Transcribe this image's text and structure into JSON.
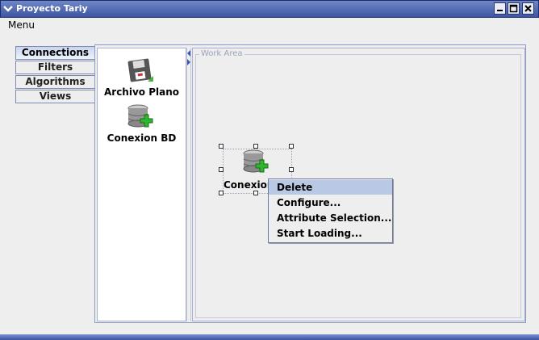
{
  "window": {
    "title": "Proyecto Tariy"
  },
  "menu": {
    "label": "Menu"
  },
  "tabs": [
    {
      "label": "Connections",
      "selected": true
    },
    {
      "label": "Filters",
      "selected": false
    },
    {
      "label": "Algorithms",
      "selected": false
    },
    {
      "label": "Views",
      "selected": false
    }
  ],
  "palette": {
    "items": [
      {
        "label": "Archivo Plano",
        "icon": "floppy-disk-icon"
      },
      {
        "label": "Conexion BD",
        "icon": "database-add-icon"
      }
    ]
  },
  "work_area": {
    "legend": "Work Area",
    "node": {
      "label": "Conexion",
      "icon": "database-add-icon"
    }
  },
  "context_menu": {
    "items": [
      {
        "label": "Delete",
        "highlighted": true
      },
      {
        "label": "Configure..."
      },
      {
        "label": "Attribute Selection..."
      },
      {
        "label": "Start Loading..."
      }
    ]
  },
  "colors": {
    "titlebar": "#4a60ad",
    "selection": "#b8c8e5",
    "db_green": "#2fb52f"
  }
}
